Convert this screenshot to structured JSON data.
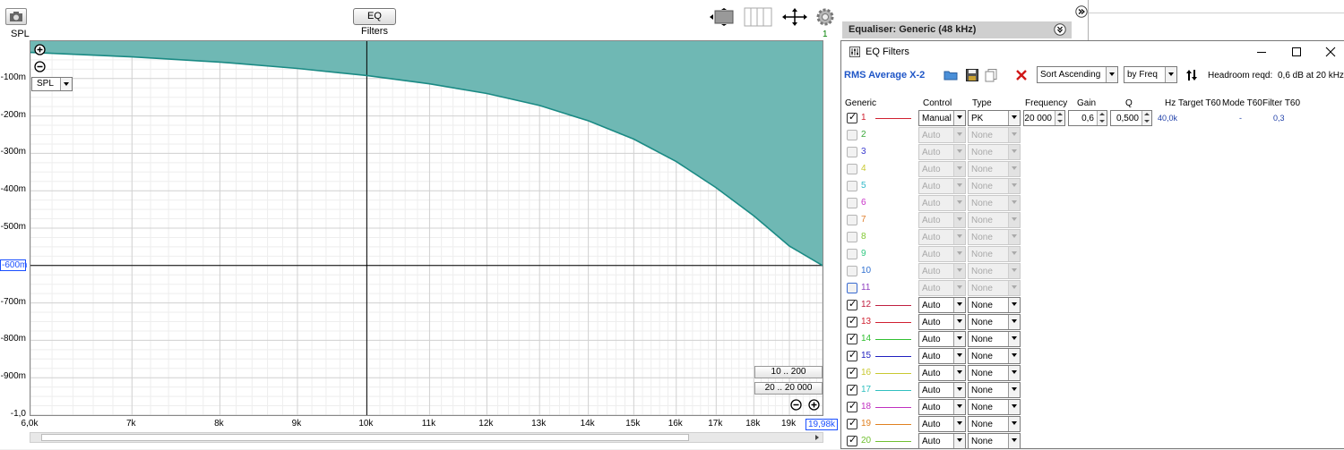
{
  "graph": {
    "y_axis_title": "SPL",
    "eq_filters_button": "EQ Filters",
    "trace_count": "1",
    "spl_select": "SPL",
    "range_buttons": [
      "10 .. 200",
      "20 .. 20 000"
    ],
    "icons": {
      "camera": "camera-icon",
      "zoom_in": "zoom-in-icon",
      "zoom_out": "zoom-out-icon",
      "resize": "resize-icon",
      "bars": "bars-icon",
      "move": "move-arrows-icon",
      "gear": "gear-icon"
    }
  },
  "chart_data": {
    "type": "area",
    "x_scale": "log",
    "x_range": [
      6000,
      19980
    ],
    "y_range": [
      -1000,
      0
    ],
    "y_unit_labels": [
      "-100m",
      "-200m",
      "-300m",
      "-400m",
      "-500m",
      "-600m",
      "-700m",
      "-800m",
      "-900m",
      "-1,0"
    ],
    "y_tick_values": [
      -100,
      -200,
      -300,
      -400,
      -500,
      -600,
      -700,
      -800,
      -900,
      -1000
    ],
    "highlighted_y_label": "-600m",
    "x_tick_labels": [
      "6,0k",
      "7k",
      "8k",
      "9k",
      "10k",
      "11k",
      "12k",
      "13k",
      "14k",
      "15k",
      "16k",
      "17k",
      "18k",
      "19k",
      "19,98k"
    ],
    "x_tick_values": [
      6000,
      7000,
      8000,
      9000,
      10000,
      11000,
      12000,
      13000,
      14000,
      15000,
      16000,
      17000,
      18000,
      19000,
      19980
    ],
    "highlighted_x_label": "19,98k",
    "reference_lines": {
      "x": 10000,
      "y": -600
    },
    "fill_color": "#6fb8b4",
    "line_color": "#1a8a84",
    "series": [
      {
        "x": [
          6000,
          7000,
          8000,
          9000,
          10000,
          11000,
          12000,
          13000,
          14000,
          15000,
          16000,
          17000,
          18000,
          19000,
          19980
        ],
        "values": [
          -30,
          -42,
          -56,
          -73,
          -92,
          -114,
          -140,
          -172,
          -213,
          -262,
          -322,
          -392,
          -467,
          -548,
          -600
        ]
      }
    ],
    "grid": true
  },
  "right": {
    "equaliser_header": "Equaliser: Generic (48 kHz)",
    "window_title": "EQ Filters",
    "measurement": "RMS Average X-2",
    "sort_combo": "Sort Ascending",
    "sortby_combo": "by Freq",
    "headroom_label": "Headroom reqd:",
    "headroom_value": "0,6 dB at 20 kHz",
    "columns": [
      "Generic",
      "Control",
      "Type",
      "Frequency",
      "Gain",
      "Q",
      "Hz",
      "Target T60",
      "Mode T60",
      "Filter T60"
    ],
    "filters": [
      {
        "index": "1",
        "checked": true,
        "enabled": true,
        "color": "#d02030",
        "control": "Manual",
        "type": "PK",
        "frequency": "20 000",
        "gain": "0,6",
        "q": "0,500",
        "hz": "40,0k",
        "mode_t60": "-",
        "filter_t60": "0,3"
      },
      {
        "index": "2",
        "checked": false,
        "enabled": false,
        "color": "#3aa83a",
        "control": "Auto",
        "type": "None"
      },
      {
        "index": "3",
        "checked": false,
        "enabled": false,
        "color": "#3a3ad0",
        "control": "Auto",
        "type": "None"
      },
      {
        "index": "4",
        "checked": false,
        "enabled": false,
        "color": "#c8c830",
        "control": "Auto",
        "type": "None"
      },
      {
        "index": "5",
        "checked": false,
        "enabled": false,
        "color": "#30b8c8",
        "control": "Auto",
        "type": "None"
      },
      {
        "index": "6",
        "checked": false,
        "enabled": false,
        "color": "#c830c8",
        "control": "Auto",
        "type": "None"
      },
      {
        "index": "7",
        "checked": false,
        "enabled": false,
        "color": "#e08030",
        "control": "Auto",
        "type": "None"
      },
      {
        "index": "8",
        "checked": false,
        "enabled": false,
        "color": "#80c830",
        "control": "Auto",
        "type": "None"
      },
      {
        "index": "9",
        "checked": false,
        "enabled": false,
        "color": "#30c880",
        "control": "Auto",
        "type": "None"
      },
      {
        "index": "10",
        "checked": false,
        "enabled": false,
        "color": "#3070d0",
        "control": "Auto",
        "type": "None"
      },
      {
        "index": "11",
        "checked": false,
        "enabled": false,
        "color": "#9040c0",
        "control": "Auto",
        "type": "None",
        "blue_box": true
      },
      {
        "index": "12",
        "checked": true,
        "enabled": true,
        "color": "#c02040",
        "control": "Auto",
        "type": "None"
      },
      {
        "index": "13",
        "checked": true,
        "enabled": true,
        "color": "#d02030",
        "control": "Auto",
        "type": "None"
      },
      {
        "index": "14",
        "checked": true,
        "enabled": true,
        "color": "#30c030",
        "control": "Auto",
        "type": "None"
      },
      {
        "index": "15",
        "checked": true,
        "enabled": true,
        "color": "#2020c0",
        "control": "Auto",
        "type": "None"
      },
      {
        "index": "16",
        "checked": true,
        "enabled": true,
        "color": "#c8c830",
        "control": "Auto",
        "type": "None"
      },
      {
        "index": "17",
        "checked": true,
        "enabled": true,
        "color": "#30c0c0",
        "control": "Auto",
        "type": "None"
      },
      {
        "index": "18",
        "checked": true,
        "enabled": true,
        "color": "#c030c0",
        "control": "Auto",
        "type": "None"
      },
      {
        "index": "19",
        "checked": true,
        "enabled": true,
        "color": "#e08020",
        "control": "Auto",
        "type": "None"
      },
      {
        "index": "20",
        "checked": true,
        "enabled": true,
        "color": "#70c030",
        "control": "Auto",
        "type": "None"
      }
    ]
  }
}
